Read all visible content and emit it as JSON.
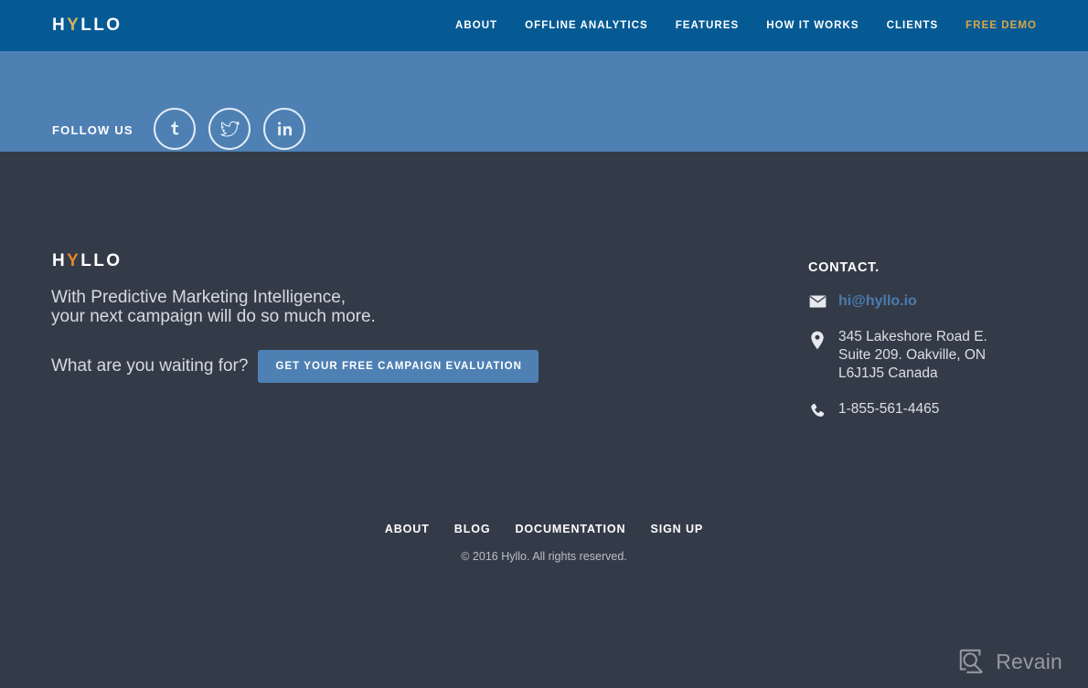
{
  "header": {
    "brand": {
      "prefix": "H",
      "accent": "Y",
      "suffix": "LLO",
      "full": "HYLLO"
    },
    "nav": [
      {
        "label": "ABOUT",
        "highlight": false
      },
      {
        "label": "OFFLINE ANALYTICS",
        "highlight": false
      },
      {
        "label": "FEATURES",
        "highlight": false
      },
      {
        "label": "HOW IT WORKS",
        "highlight": false
      },
      {
        "label": "CLIENTS",
        "highlight": false
      },
      {
        "label": "FREE DEMO",
        "highlight": true
      }
    ]
  },
  "follow": {
    "label": "FOLLOW US",
    "socials": [
      {
        "name": "tumblr",
        "icon": "tumblr-icon"
      },
      {
        "name": "twitter",
        "icon": "twitter-icon"
      },
      {
        "name": "linkedin",
        "icon": "linkedin-icon"
      }
    ]
  },
  "footer": {
    "brand": {
      "prefix": "H",
      "accent": "Y",
      "suffix": "LLO",
      "full": "HYLLO"
    },
    "tagline_line1": "With Predictive Marketing Intelligence,",
    "tagline_line2": "your next campaign will do so much more.",
    "cta_question": "What are you waiting for?",
    "cta_button": "GET YOUR FREE CAMPAIGN EVALUATION",
    "bottom_links": [
      {
        "label": "ABOUT"
      },
      {
        "label": "BLOG"
      },
      {
        "label": "DOCUMENTATION"
      },
      {
        "label": "SIGN UP"
      }
    ],
    "copyright": "© 2016 Hyllo. All rights reserved."
  },
  "contact": {
    "title": "CONTACT.",
    "email": "hi@hyllo.io",
    "address": "345 Lakeshore Road E.\nSuite 209. Oakville, ON\nL6J1J5 Canada",
    "phone": "1-855-561-4465"
  },
  "watermark": {
    "text": "Revain"
  },
  "colors": {
    "header_blue": "#065a94",
    "band_blue": "#4e80b4",
    "footer_slate": "#343b48",
    "header_accent_gold": "#d6b161",
    "nav_demo_gold": "#d7a74b",
    "footer_accent_orange": "#e8862c",
    "email_link_blue": "#4a7cb0",
    "body_text": "#d6dae0"
  }
}
